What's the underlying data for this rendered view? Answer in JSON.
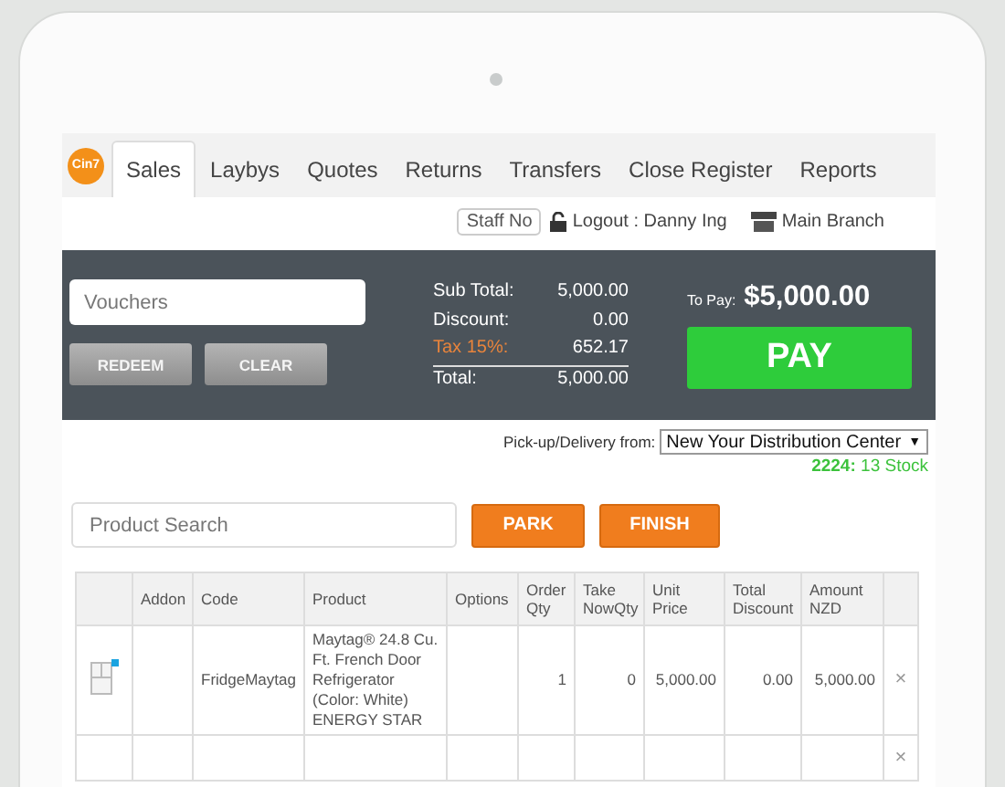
{
  "logo": "Cin7",
  "tabs": [
    {
      "label": "Sales",
      "selected": true
    },
    {
      "label": "Laybys",
      "selected": false
    },
    {
      "label": "Quotes",
      "selected": false
    },
    {
      "label": "Returns",
      "selected": false
    },
    {
      "label": "Transfers",
      "selected": false
    },
    {
      "label": "Close Register",
      "selected": false
    },
    {
      "label": "Reports",
      "selected": false
    }
  ],
  "user_bar": {
    "staff": "Staff No",
    "logout": "Logout : Danny Ing",
    "branch": "Main Branch"
  },
  "voucher": {
    "placeholder": "Vouchers",
    "buttons": [
      "REDEEM",
      "CLEAR"
    ]
  },
  "totals": [
    {
      "label": "Sub Total:",
      "value": "5,000.00",
      "kind": "normal"
    },
    {
      "label": "Discount:",
      "value": "0.00",
      "kind": "normal"
    },
    {
      "label": "Tax 15%:",
      "value": "652.17",
      "kind": "tax"
    },
    {
      "label": "Total:",
      "value": "5,000.00",
      "kind": "total"
    }
  ],
  "to_pay": {
    "label": "To Pay:",
    "amount": "$5,000.00",
    "button": "PAY"
  },
  "delivery": {
    "label": "Pick-up/Delivery from:",
    "value": "New Your Distribution Center",
    "caret": "▼",
    "stock_code": "2224:",
    "stock": "13 Stock"
  },
  "product_search": {
    "placeholder": "Product Search"
  },
  "actions": [
    "PARK",
    "FINISH"
  ],
  "table": {
    "columns": [
      "",
      "Addon",
      "Code",
      "Product",
      "Options",
      "Order Qty",
      "Take NowQty",
      "Unit Price",
      "Total Discount",
      "Amount NZD",
      ""
    ],
    "rows": [
      {
        "kind": "item",
        "cells": [
          "",
          "",
          "FridgeMaytag",
          "Maytag® 24.8 Cu. Ft. French Door Refrigerator (Color: White) ENERGY STAR",
          "",
          "1",
          "0",
          "5,000.00",
          "0.00",
          "5,000.00"
        ],
        "remove": "×"
      },
      {
        "kind": "empty",
        "cells": [
          "",
          "",
          "",
          "",
          "",
          "",
          "",
          "",
          "",
          ""
        ],
        "remove": "×"
      }
    ]
  }
}
